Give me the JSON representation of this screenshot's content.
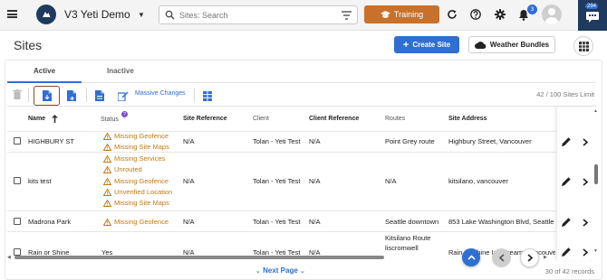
{
  "app": {
    "title": "V3 Yeti Demo",
    "search_placeholder": "Sites: Search",
    "training_label": "Training",
    "notification_count": "3",
    "messages_count": "294"
  },
  "page": {
    "title": "Sites",
    "create_label": "Create Site",
    "weather_label": "Weather Bundles"
  },
  "tabs": [
    {
      "label": "Active",
      "selected": true
    },
    {
      "label": "Inactive",
      "selected": false
    }
  ],
  "toolbar": {
    "massive_changes_label": "Massive Changes",
    "sites_limit": "42 / 100 Sites Limit"
  },
  "table": {
    "columns": [
      "Name",
      "Status",
      "Site Reference",
      "Client",
      "Client Reference",
      "Routes",
      "Site Address"
    ],
    "rows": [
      {
        "name": "HIGHBURY ST",
        "status": [
          "Missing Geofence",
          "Missing Site Maps"
        ],
        "site_reference": "N/A",
        "client": "Tolan - Yeti Test",
        "client_reference": "N/A",
        "routes": "Point Grey route",
        "address": "Highbury Street, Vancouver"
      },
      {
        "name": "kits test",
        "status": [
          "Missing Services",
          "Unrouted",
          "Missing Geofence",
          "Unverified Location",
          "Missing Site Maps"
        ],
        "site_reference": "N/A",
        "client": "Tolan - Yeti Test",
        "client_reference": "N/A",
        "routes": "N/A",
        "address": "kitsilano, vancouver"
      },
      {
        "name": "Madrona Park",
        "status": [
          "Missing Geofence"
        ],
        "site_reference": "N/A",
        "client": "Tolan - Yeti Test",
        "client_reference": "N/A",
        "routes": "Seattle downtown",
        "address": "853 Lake Washington Blvd, Seattle"
      },
      {
        "name": "Rain or Shine",
        "status_text": "Yes",
        "site_reference": "N/A",
        "client": "Tolan - Yeti Test",
        "client_reference": "N/A",
        "routes": "Kitsilano Route",
        "routes_extra": "liscromwell",
        "address": "Rain or Shine Ice Cream, Vancouve"
      }
    ]
  },
  "footer": {
    "next_page_label": "Next Page",
    "records": "30 of 42 records"
  },
  "colors": {
    "primary": "#2f6fd1",
    "training": "#c8712c",
    "warning": "#c17a12",
    "brand_dark": "#1f3a5c"
  }
}
